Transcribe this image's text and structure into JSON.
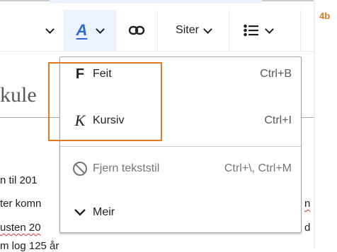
{
  "annotation": {
    "step_label": "4b",
    "color": "#e07b24"
  },
  "toolbar": {
    "style_button": {
      "icon": "A",
      "color": "#3366cc"
    },
    "cite_label": "Siter"
  },
  "article": {
    "heading_fragment": "kule",
    "lines": [
      {
        "text": "n til 201"
      },
      {
        "text": "ter komn"
      },
      {
        "text": "usten 20"
      },
      {
        "text": "m log 125 år"
      }
    ],
    "right_fragments": [
      "n",
      "d"
    ]
  },
  "menu": {
    "items": [
      {
        "label": "Feit",
        "icon": "F",
        "icon_name": "bold-icon",
        "shortcut": "Ctrl+B"
      },
      {
        "label": "Kursiv",
        "icon": "K",
        "icon_name": "italic-icon",
        "shortcut": "Ctrl+I"
      },
      {
        "label": "Fjern tekststil",
        "icon_name": "clear-style-icon",
        "shortcut": "Ctrl+\\, Ctrl+M"
      },
      {
        "label": "Meir",
        "icon_name": "chevron-down-icon"
      }
    ]
  }
}
